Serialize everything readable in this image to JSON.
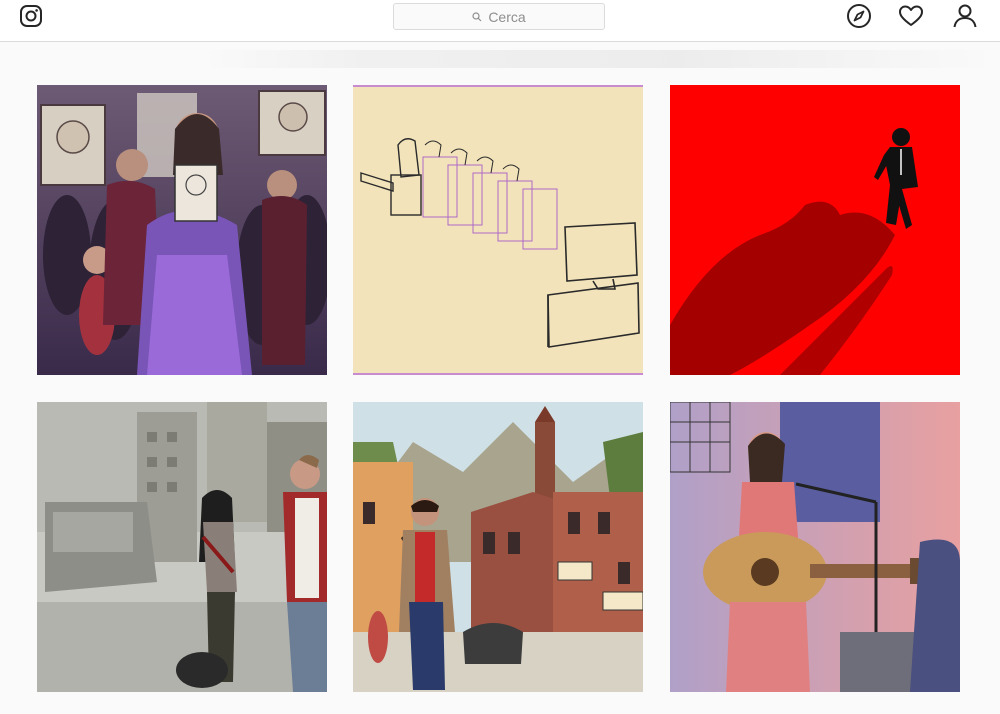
{
  "header": {
    "logo_icon": "instagram-icon",
    "search": {
      "placeholder": "Cerca",
      "icon": "search-icon"
    },
    "nav_icons": [
      "explore-compass-icon",
      "heart-icon",
      "profile-user-icon"
    ]
  },
  "posts": [
    {
      "subject": "crowd-with-portrait-illustration"
    },
    {
      "subject": "courtroom-sketch-illustration"
    },
    {
      "subject": "man-on-red-with-shadow-illustration"
    },
    {
      "subject": "street-couple-illustration"
    },
    {
      "subject": "guitar-man-in-town-illustration"
    },
    {
      "subject": "singer-with-guitar-illustration"
    }
  ],
  "colors": {
    "background": "#fafafa",
    "header_bg": "#ffffff",
    "border": "#dbdbdb",
    "placeholder": "#8e8e8e",
    "red_tile": "#ff0000"
  }
}
